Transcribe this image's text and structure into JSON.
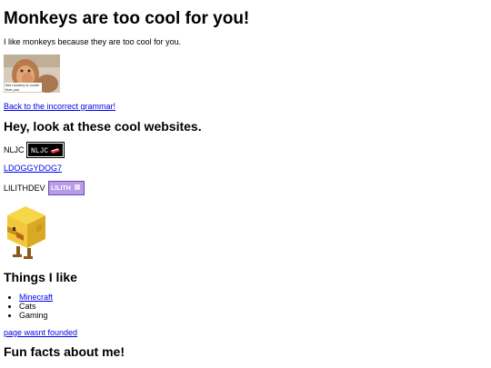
{
  "page": {
    "title": "Monkeys are too cool for you!",
    "intro": "I like monkeys because they are too cool for you.",
    "monkey_image": {
      "caption": "this monkey is cooler than you"
    },
    "back_link": "Back to the incorrect grammar!",
    "sites_heading": "Hey, look at these cool websites.",
    "sites": [
      {
        "label": "NLJC",
        "badge_text": "NLJC"
      },
      {
        "label": "LDOGGYDOG7"
      },
      {
        "label": "LILITHDEV",
        "badge_text": "LILITH"
      }
    ],
    "things_heading": "Things I like",
    "likes": [
      {
        "label": "Minecraft",
        "is_link": true
      },
      {
        "label": "Cats",
        "is_link": false
      },
      {
        "label": "Gaming",
        "is_link": false
      }
    ],
    "not_found_link": "page wasnt founded",
    "facts_heading": "Fun facts about me!"
  },
  "colors": {
    "link": "#0000ee",
    "badge_lilith": "#b89ce8",
    "chick_yellow": "#f2c83a"
  }
}
